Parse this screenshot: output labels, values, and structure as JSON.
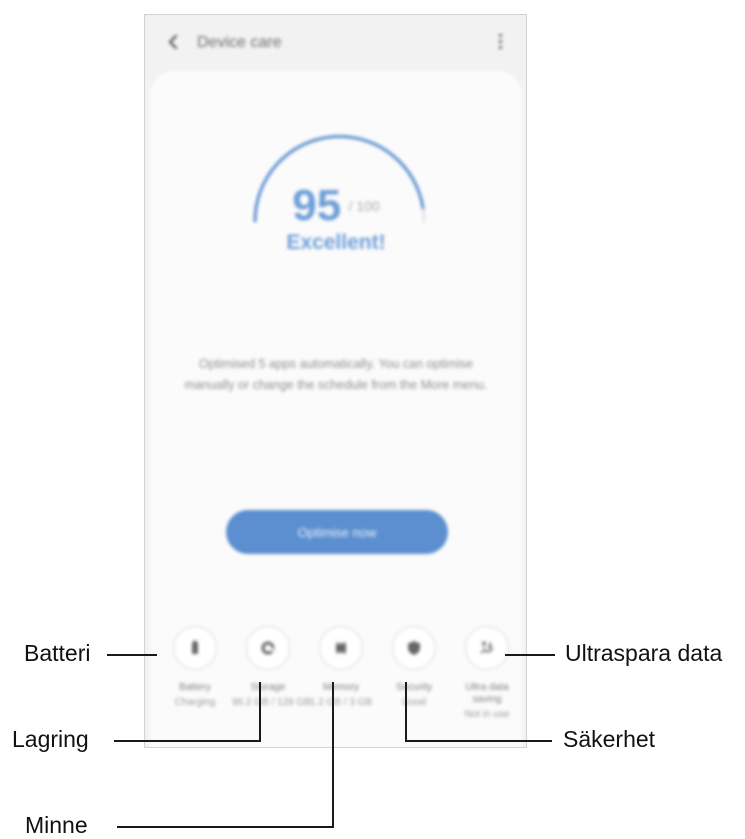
{
  "header": {
    "title": "Device care"
  },
  "score": {
    "value": "95",
    "max": "/ 100",
    "fraction": 0.95,
    "status": "Excellent!"
  },
  "description": "Optimised 5 apps automatically. You can optimise manually or change the schedule from the More menu.",
  "optimize_button": "Optimise now",
  "tiles": [
    {
      "label": "Battery",
      "value": "Charging",
      "icon": "battery-icon"
    },
    {
      "label": "Storage",
      "value": "96.2 GB / 128 GB",
      "icon": "storage-icon"
    },
    {
      "label": "Memory",
      "value": "1.2 GB / 3 GB",
      "icon": "memory-icon"
    },
    {
      "label": "Security",
      "value": "Good",
      "icon": "shield-icon"
    },
    {
      "label": "Ultra data saving",
      "value": "Not in use",
      "icon": "data-saving-icon"
    }
  ],
  "callouts": {
    "battery": "Batteri",
    "storage": "Lagring",
    "memory": "Minne",
    "security": "Säkerhet",
    "data_saving": "Ultraspara data"
  },
  "colors": {
    "accent": "#5b8fd0",
    "score_text": "#6e9fd8"
  }
}
